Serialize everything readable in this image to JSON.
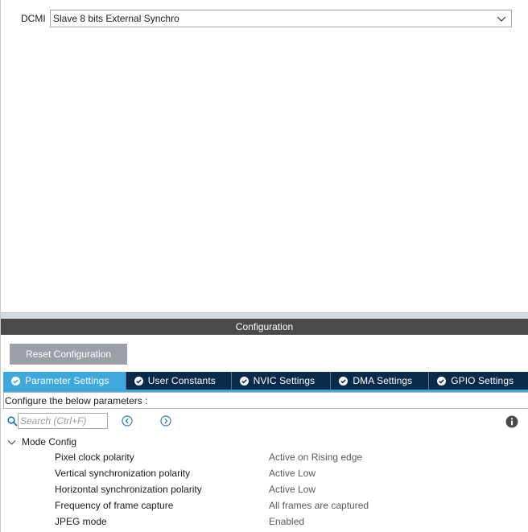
{
  "mode": {
    "label": "DCMI",
    "selected_value": "Slave 8 bits External Synchro"
  },
  "configuration": {
    "header_title": "Configuration",
    "reset_button_label": "Reset Configuration",
    "tabs": [
      {
        "label": "Parameter Settings",
        "active": true
      },
      {
        "label": "User Constants",
        "active": false
      },
      {
        "label": "NVIC Settings",
        "active": false
      },
      {
        "label": "DMA Settings",
        "active": false
      },
      {
        "label": "GPIO Settings",
        "active": false
      }
    ],
    "instruction_text": "Configure the below parameters :",
    "search": {
      "placeholder": "Search (Ctrl+F)",
      "value": ""
    },
    "tree": {
      "group_label": "Mode Config",
      "parameters": [
        {
          "name": "Pixel clock polarity",
          "value": "Active on Rising edge"
        },
        {
          "name": "Vertical synchronization polarity",
          "value": "Active Low"
        },
        {
          "name": "Horizontal synchronization polarity",
          "value": "Active Low"
        },
        {
          "name": "Frequency of frame capture",
          "value": "All frames are captured"
        },
        {
          "name": "JPEG mode",
          "value": "Enabled"
        }
      ]
    }
  },
  "colors": {
    "tab_bar_bg": "#0a2a4a",
    "tab_active_bg": "#3ea7dc",
    "header_bg": "#4a4a4a",
    "reset_button_bg": "#9aa0a6"
  },
  "icons": {
    "dropdown": "chevron-down-icon",
    "tab_status": "check-circle-icon",
    "search": "search-icon",
    "previous": "arrow-left-circle-icon",
    "next": "arrow-right-circle-icon",
    "info": "info-icon",
    "tree_expand": "chevron-down-icon"
  }
}
